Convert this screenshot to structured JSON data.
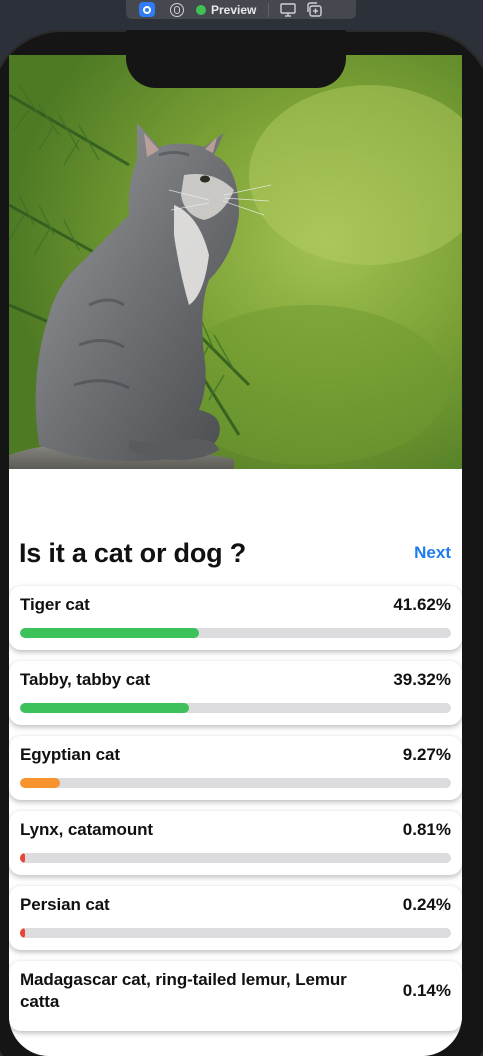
{
  "toolbar": {
    "live_icon": "live-preview-icon",
    "select_icon": "selectable-icon",
    "preview_label": "Preview",
    "device_icon": "device-settings-icon",
    "duplicate_icon": "duplicate-preview-icon"
  },
  "screen": {
    "image_subject": "kitten-photo",
    "title": "Is it a cat or dog ?",
    "next_label": "Next"
  },
  "results": [
    {
      "label": "Tiger cat",
      "percent": "41.62%",
      "value": 0.4162,
      "color": "#3cc15b"
    },
    {
      "label": "Tabby, tabby cat",
      "percent": "39.32%",
      "value": 0.3932,
      "color": "#3cc15b"
    },
    {
      "label": "Egyptian cat",
      "percent": "9.27%",
      "value": 0.0927,
      "color": "#f7922d"
    },
    {
      "label": "Lynx, catamount",
      "percent": "0.81%",
      "value": 0.0081,
      "color": "#ea4436"
    },
    {
      "label": "Persian cat",
      "percent": "0.24%",
      "value": 0.0024,
      "color": "#ea4436"
    },
    {
      "label": "Madagascar cat, ring-tailed lemur, Lemur catta",
      "percent": "0.14%",
      "value": 0.0014,
      "color": "#ea4436"
    }
  ]
}
